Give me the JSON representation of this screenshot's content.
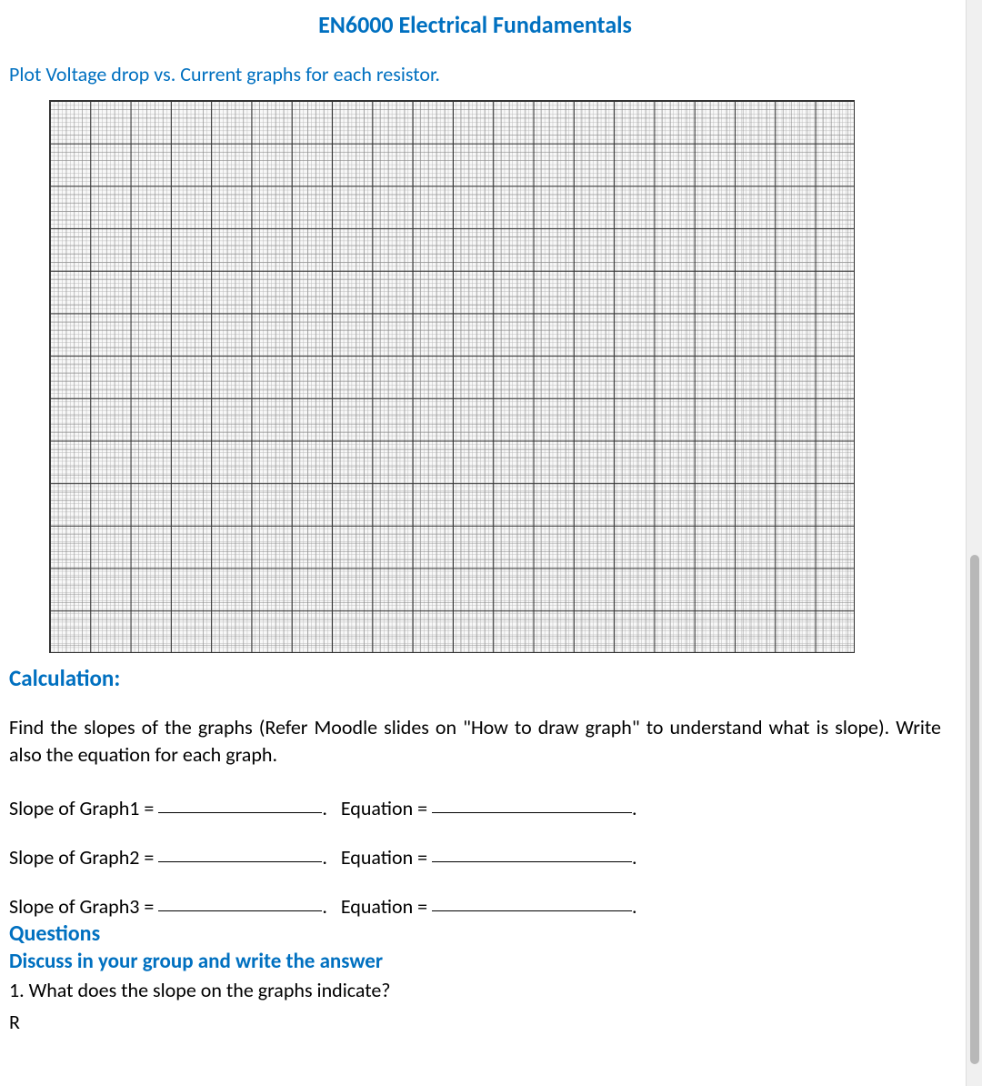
{
  "header": {
    "title": "EN6000 Electrical Fundamentals"
  },
  "instruction": "Plot Voltage drop vs. Current graphs for each resistor.",
  "calculation": {
    "heading": "Calculation:",
    "description": "Find the slopes of the graphs (Refer Moodle slides on \"How to draw graph\" to understand what is slope). Write also the equation for each graph.",
    "rows": [
      {
        "slopeLabel": "Slope of Graph1 =",
        "eqLabel": "Equation ="
      },
      {
        "slopeLabel": "Slope of Graph2 =",
        "eqLabel": "Equation ="
      },
      {
        "slopeLabel": "Slope of Graph3 =",
        "eqLabel": "Equation ="
      }
    ]
  },
  "questions": {
    "heading": "Questions",
    "discuss": "Discuss in your group and write the answer",
    "q1": "1. What does the slope on the graphs indicate?",
    "rLine": "R"
  }
}
